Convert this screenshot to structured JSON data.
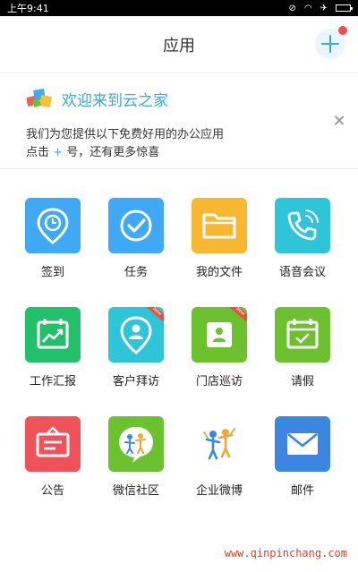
{
  "status_bar": {
    "time": "上午9:41"
  },
  "header": {
    "title": "应用"
  },
  "banner": {
    "title": "欢迎来到云之家",
    "line1": "我们为您提供以下免费好用的办公应用",
    "line2_prefix": "点击",
    "line2_plus": "+",
    "line2_suffix": "号，还有更多惊喜"
  },
  "apps": [
    {
      "label": "签到",
      "icon": "location-clock-icon",
      "color": "#3fa9f5"
    },
    {
      "label": "任务",
      "icon": "checkmark-icon",
      "color": "#3fa9f5"
    },
    {
      "label": "我的文件",
      "icon": "folder-icon",
      "color": "#f7b731"
    },
    {
      "label": "语音会议",
      "icon": "phone-icon",
      "color": "#2ec5d9"
    },
    {
      "label": "工作汇报",
      "icon": "calendar-chart-icon",
      "color": "#22c06a"
    },
    {
      "label": "客户拜访",
      "icon": "location-person-icon",
      "color": "#2ec5d9",
      "badge": "New"
    },
    {
      "label": "门店巡访",
      "icon": "store-icon",
      "color": "#6cc12e",
      "badge": "New"
    },
    {
      "label": "请假",
      "icon": "calendar-check-icon",
      "color": "#6cc12e"
    },
    {
      "label": "公告",
      "icon": "notice-board-icon",
      "color": "#f0525a"
    },
    {
      "label": "微信社区",
      "icon": "chat-people-icon",
      "color": "#6cc12e"
    },
    {
      "label": "企业微博",
      "icon": "people-icon",
      "color": "#ffffff"
    },
    {
      "label": "邮件",
      "icon": "mail-icon",
      "color": "#3b86e0"
    }
  ],
  "watermark": "www.qinpinchang.com"
}
